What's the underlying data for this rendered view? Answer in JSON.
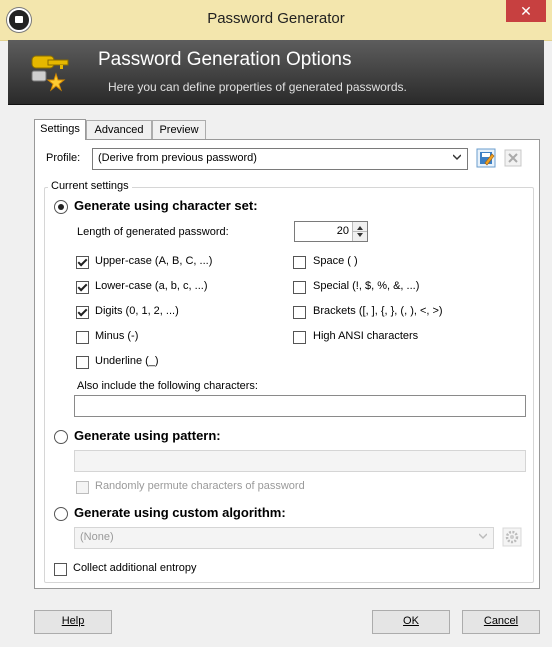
{
  "window": {
    "title": "Password Generator"
  },
  "banner": {
    "title": "Password Generation Options",
    "subtitle": "Here you can define properties of generated passwords."
  },
  "tabs": [
    "Settings",
    "Advanced",
    "Preview"
  ],
  "profile": {
    "label": "Profile:",
    "value": "(Derive from previous password)"
  },
  "current_settings": {
    "label": "Current settings"
  },
  "charset": {
    "radio_label": "Generate using character set:",
    "length_label": "Length of generated password:",
    "length_value": "20",
    "checks": [
      {
        "label": "Upper-case (A, B, C, ...)",
        "checked": true
      },
      {
        "label": "Lower-case (a, b, c, ...)",
        "checked": true
      },
      {
        "label": "Digits (0, 1, 2, ...)",
        "checked": true
      },
      {
        "label": "Minus (-)",
        "checked": false
      },
      {
        "label": "Underline (_)",
        "checked": false
      },
      {
        "label": "Space ( )",
        "checked": false
      },
      {
        "label": "Special (!, $, %, &, ...)",
        "checked": false
      },
      {
        "label": "Brackets ([, ], {, }, (, ), <, >)",
        "checked": false
      },
      {
        "label": "High ANSI characters",
        "checked": false
      }
    ],
    "also_include_label": "Also include the following characters:",
    "also_include_value": ""
  },
  "pattern": {
    "radio_label": "Generate using pattern:",
    "value": "",
    "permute_label": "Randomly permute characters of password"
  },
  "custom": {
    "radio_label": "Generate using custom algorithm:",
    "value": "(None)"
  },
  "entropy": {
    "label": "Collect additional entropy"
  },
  "buttons": {
    "help": "Help",
    "ok": "OK",
    "cancel": "Cancel"
  }
}
